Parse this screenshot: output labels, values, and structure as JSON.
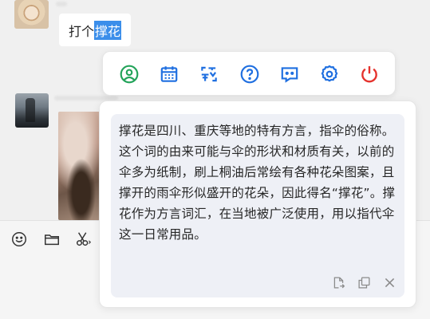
{
  "chat": {
    "message_prefix": "打个",
    "message_selected": "撑花"
  },
  "action_bar": {
    "icons": [
      "user-circle-icon",
      "calendar-icon",
      "translate-icon",
      "help-icon",
      "chat-bubble-icon",
      "settings-icon",
      "power-icon"
    ],
    "accent_colors": {
      "green": "#23a35a",
      "blue": "#1f6fe0",
      "red": "#e5322d"
    }
  },
  "answer": {
    "text": "撑花是四川、重庆等地的特有方言，指伞的俗称。这个词的由来可能与伞的形状和材质有关，以前的伞多为纸制，刷上桐油后常绘有各种花朵图案，且撑开的雨伞形似盛开的花朵，因此得名“撑花”。撑花作为方言词汇，在当地被广泛使用，用以指代伞这一日常用品。",
    "actions": [
      "insert-icon",
      "copy-icon",
      "close-icon"
    ]
  },
  "composer": {
    "tools": [
      "emoji-icon",
      "folder-icon",
      "scissors-icon"
    ]
  }
}
